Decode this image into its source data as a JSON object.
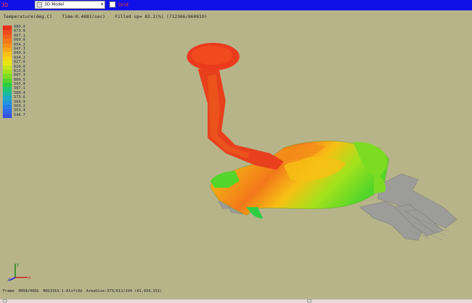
{
  "window": {
    "app_label": "3D",
    "view_select": "3D Model",
    "view_select_arrow": "▾",
    "checkbox_label": "Grid",
    "checkbox_checked": false,
    "titlebar_color": "#1010e8"
  },
  "status": {
    "quantity": "Temperature(deg.C)",
    "time": "Time:0.4081(sec)",
    "filled": "Filled up= 83.2(%) (712366/860819)"
  },
  "legend": {
    "items": [
      {
        "label": "680.0",
        "color": "#e8301c"
      },
      {
        "label": "673.0",
        "color": "#ed4a1c"
      },
      {
        "label": "667.1",
        "color": "#f0601c"
      },
      {
        "label": "660.0",
        "color": "#f2781a"
      },
      {
        "label": "654.2",
        "color": "#f48e18"
      },
      {
        "label": "647.3",
        "color": "#f6a616"
      },
      {
        "label": "640.9",
        "color": "#f7c014"
      },
      {
        "label": "634.2",
        "color": "#f4d612"
      },
      {
        "label": "627.0",
        "color": "#e4e614"
      },
      {
        "label": "620.6",
        "color": "#c4e618"
      },
      {
        "label": "613.8",
        "color": "#a2e21c"
      },
      {
        "label": "607.3",
        "color": "#7cdc22"
      },
      {
        "label": "600.5",
        "color": "#52d62a"
      },
      {
        "label": "593.8",
        "color": "#2ece42"
      },
      {
        "label": "587.1",
        "color": "#1ec474"
      },
      {
        "label": "580.4",
        "color": "#1cb8a0"
      },
      {
        "label": "573.6",
        "color": "#1ea8c8"
      },
      {
        "label": "566.9",
        "color": "#2294e0"
      },
      {
        "label": "560.2",
        "color": "#287ee8"
      },
      {
        "label": "553.4",
        "color": "#3068e8"
      },
      {
        "label": "546.7",
        "color": "#3854e0"
      }
    ]
  },
  "axis": {
    "x": "x",
    "y": "y",
    "z": "z"
  },
  "bottom_status": {
    "frame": "Frame",
    "frame_counts": "0058/0081",
    "file": "B01331S-1-Aloft3d",
    "area": "AreaSize:373/611/194 (41,934,152)"
  }
}
